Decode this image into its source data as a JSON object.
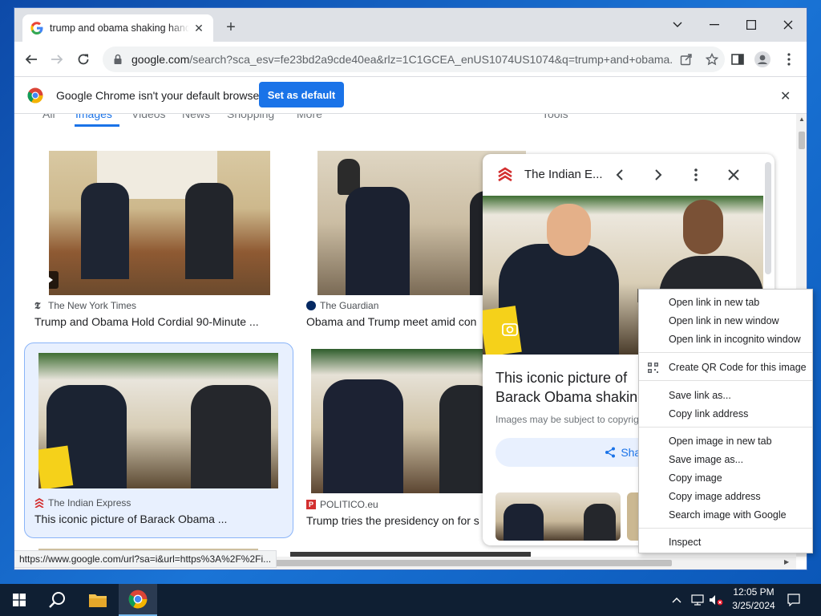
{
  "browser": {
    "tab_title": "trump and obama shaking hands - Google Search",
    "url_domain": "google.com",
    "url_rest": "/search?sca_esv=fe23bd2a9cde40ea&rlz=1C1GCEA_enUS1074US1074&q=trump+and+obama..."
  },
  "infobar": {
    "message": "Google Chrome isn't your default browser",
    "button": "Set as default"
  },
  "search_tabs": [
    "All",
    "Images",
    "Videos",
    "News",
    "Shopping",
    "More",
    "Tools"
  ],
  "results": [
    {
      "source": "The New York Times",
      "caption": "Trump and Obama Hold Cordial 90-Minute ..."
    },
    {
      "source": "The Guardian",
      "caption": "Obama and Trump meet amid con"
    },
    {
      "source": "The Indian Express",
      "caption": "This iconic picture of Barack Obama ..."
    },
    {
      "source": "POLITICO.eu",
      "caption": "Trump tries the presidency on for s"
    }
  ],
  "panel": {
    "source": "The Indian E...",
    "title": "This iconic picture of Barack Obama shaking",
    "copyright": "Images may be subject to copyrig",
    "share": "Share"
  },
  "context_menu": {
    "items": [
      "Open link in new tab",
      "Open link in new window",
      "Open link in incognito window",
      "Create QR Code for this image",
      "Save link as...",
      "Copy link address",
      "Open image in new tab",
      "Save image as...",
      "Copy image",
      "Copy image address",
      "Search image with Google",
      "Inspect"
    ]
  },
  "status_url": "https://www.google.com/url?sa=i&url=https%3A%2F%2Fi...",
  "taskbar": {
    "time": "12:05 PM",
    "date": "3/25/2024"
  },
  "colors": {
    "accent": "#1a73e8",
    "selected_card": "#e8f0fe",
    "tabstrip": "#dee1e6"
  }
}
